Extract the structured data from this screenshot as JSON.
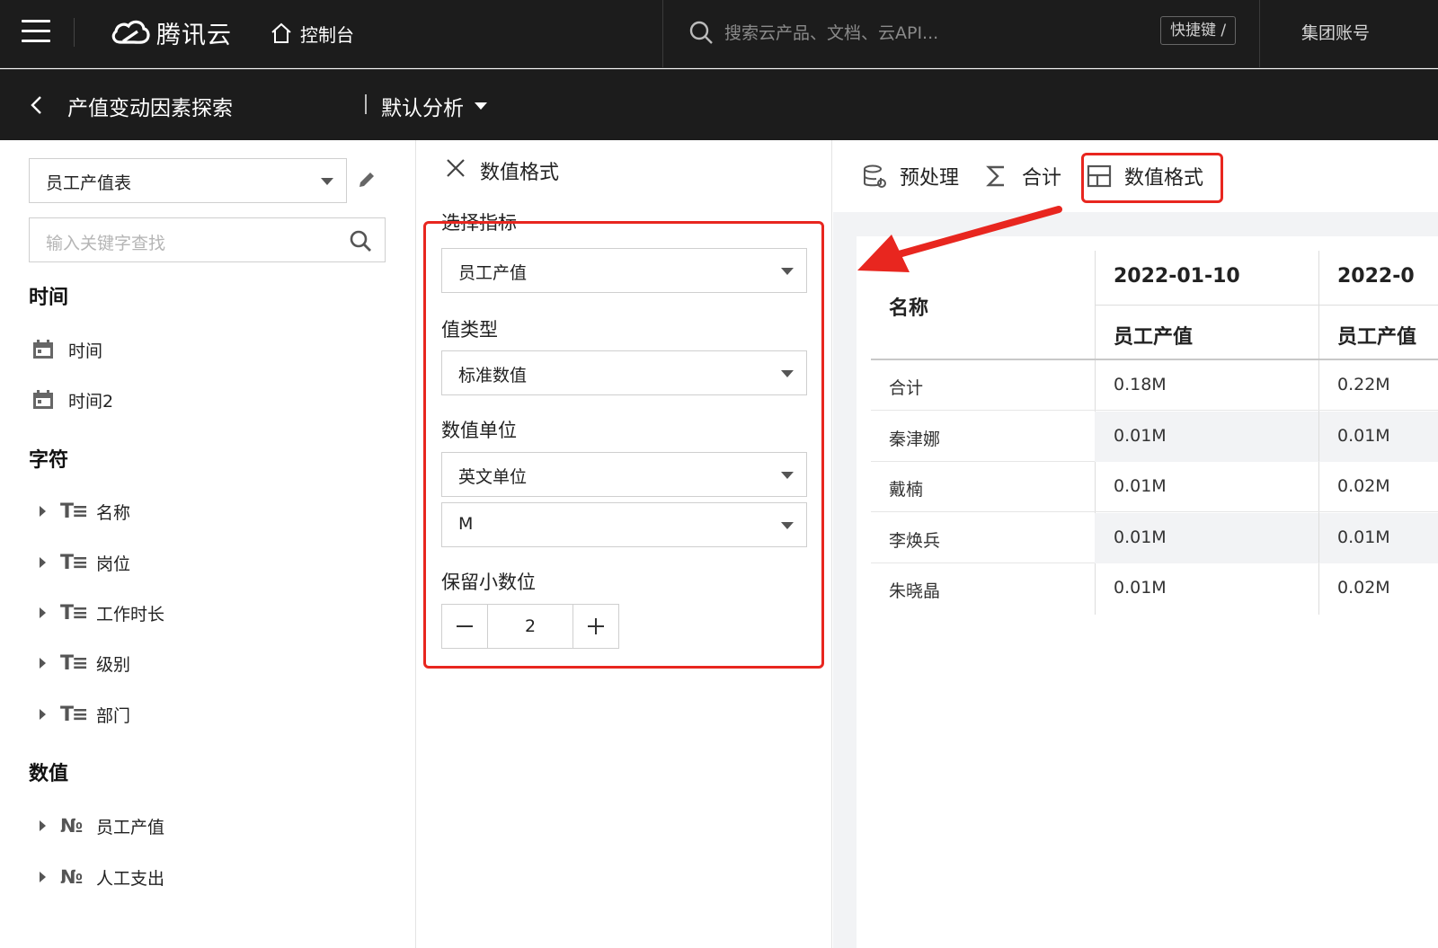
{
  "topbar": {
    "brand": "腾讯云",
    "console": "控制台",
    "search_placeholder": "搜索云产品、文档、云API...",
    "shortcut": "快捷键 /",
    "account": "集团账号"
  },
  "subbar": {
    "title": "产值变动因素探索",
    "analysis": "默认分析"
  },
  "left": {
    "table_select": "员工产值表",
    "search_placeholder": "输入关键字查找",
    "groups": {
      "time": "时间",
      "char": "字符",
      "num": "数值"
    },
    "time_fields": [
      "时间",
      "时间2"
    ],
    "char_fields": [
      "名称",
      "岗位",
      "工作时长",
      "级别",
      "部门"
    ],
    "num_fields": [
      "员工产值",
      "人工支出"
    ],
    "type_glyph_text": "T",
    "type_glyph_num": "№"
  },
  "format_panel": {
    "title": "数值格式",
    "metric_label": "选择指标",
    "metric_value": "员工产值",
    "value_type_label": "值类型",
    "value_type": "标准数值",
    "unit_label": "数值单位",
    "unit": "英文单位",
    "unit_scale": "M",
    "decimals_label": "保留小数位",
    "decimals": "2"
  },
  "toolbar": {
    "preprocess": "预处理",
    "total": "合计",
    "format": "数值格式"
  },
  "table": {
    "name_header": "名称",
    "date_cols": [
      "2022-01-10",
      "2022-0"
    ],
    "measure_cols": [
      "员工产值",
      "员工产值"
    ],
    "rows": [
      {
        "name": "合计",
        "v1": "0.18M",
        "v2": "0.22M"
      },
      {
        "name": "秦津娜",
        "v1": "0.01M",
        "v2": "0.01M"
      },
      {
        "name": "戴楠",
        "v1": "0.01M",
        "v2": "0.02M"
      },
      {
        "name": "李焕兵",
        "v1": "0.01M",
        "v2": "0.01M"
      },
      {
        "name": "朱晓晶",
        "v1": "0.01M",
        "v2": "0.02M"
      }
    ]
  },
  "colors": {
    "dark_bar": "#1c1c1c",
    "highlight": "#e8261f",
    "row_shade": "#f2f3f5"
  }
}
